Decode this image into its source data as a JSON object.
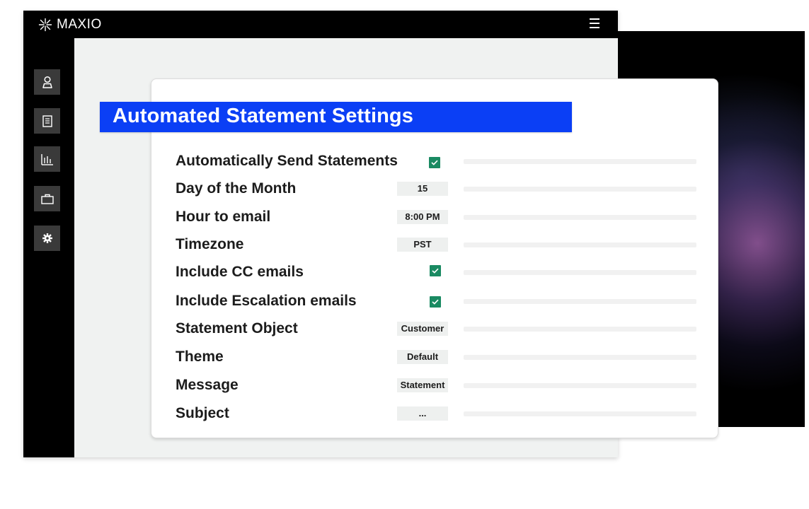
{
  "app": {
    "brand": "MAXIO",
    "menu_icon": "hamburger-icon"
  },
  "sidebar": {
    "items": [
      {
        "icon": "user-icon"
      },
      {
        "icon": "document-icon"
      },
      {
        "icon": "bar-chart-icon"
      },
      {
        "icon": "briefcase-icon"
      },
      {
        "icon": "gear-icon"
      }
    ]
  },
  "settings": {
    "title": "Automated Statement Settings",
    "rows": [
      {
        "label": "Automatically Send Statements",
        "type": "checkbox",
        "checked": true
      },
      {
        "label": "Day of the Month",
        "type": "value",
        "value": "15"
      },
      {
        "label": "Hour to email",
        "type": "value",
        "value": "8:00 PM"
      },
      {
        "label": "Timezone",
        "type": "value",
        "value": "PST"
      },
      {
        "label": "Include CC emails",
        "type": "checkbox",
        "checked": true
      },
      {
        "label": "Include Escalation emails",
        "type": "checkbox",
        "checked": true
      },
      {
        "label": "Statement Object",
        "type": "value",
        "value": "Customer"
      },
      {
        "label": "Theme",
        "type": "value",
        "value": "Default"
      },
      {
        "label": "Message",
        "type": "value",
        "value": "Statement"
      },
      {
        "label": "Subject",
        "type": "value",
        "value": "..."
      }
    ]
  },
  "colors": {
    "accent_blue": "#0b3ff5",
    "check_green": "#1a8a62",
    "sidebar_button": "#3a3a3a"
  }
}
